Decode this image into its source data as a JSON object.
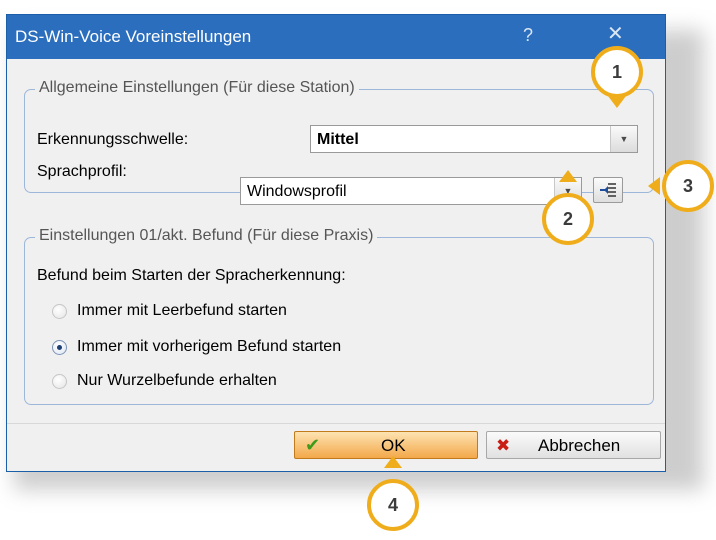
{
  "window": {
    "title": "DS-Win-Voice Voreinstellungen",
    "help_label": "?",
    "close_label": "✕"
  },
  "general": {
    "legend": "Allgemeine Einstellungen (Für diese Station)",
    "threshold_label": "Erkennungsschwelle:",
    "threshold_value": "Mittel",
    "profile_label": "Sprachprofil:",
    "profile_value": "Windowsprofil",
    "profile_button_icon": "list-arrow-icon"
  },
  "findings": {
    "legend": "Einstellungen 01/akt. Befund (Für diese Praxis)",
    "prompt": "Befund beim Starten der Spracherkennung:",
    "options": [
      {
        "label": "Immer mit Leerbefund starten",
        "selected": false
      },
      {
        "label": "Immer mit vorherigem Befund starten",
        "selected": true
      },
      {
        "label": "Nur Wurzelbefunde erhalten",
        "selected": false
      }
    ]
  },
  "footer": {
    "ok_label": "OK",
    "ok_icon": "checkmark-icon",
    "cancel_label": "Abbrechen",
    "cancel_icon": "x-icon"
  },
  "callouts": [
    "1",
    "2",
    "3",
    "4"
  ],
  "colors": {
    "titlebar": "#2a6ebd",
    "callout_border": "#f0ad1b",
    "ok_button": "#f3a84a"
  }
}
